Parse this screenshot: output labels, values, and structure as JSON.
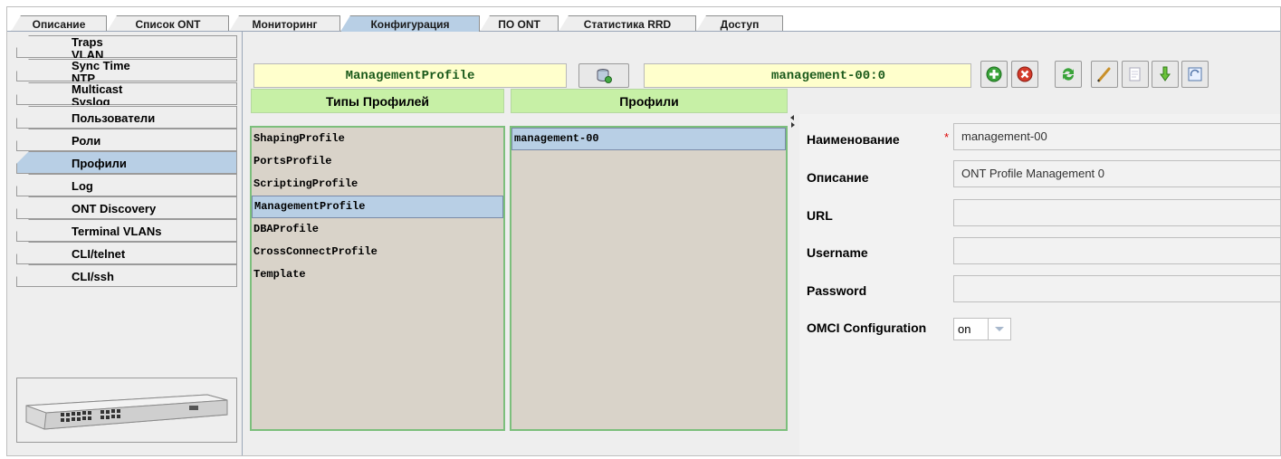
{
  "tabs": [
    {
      "label": "Описание",
      "active": false
    },
    {
      "label": "Список ONT",
      "active": false
    },
    {
      "label": "Мониторинг",
      "active": false
    },
    {
      "label": "Конфигурация",
      "active": true
    },
    {
      "label": "ПО ONT",
      "active": false
    },
    {
      "label": "Статистика RRD",
      "active": false
    },
    {
      "label": "Доступ",
      "active": false
    }
  ],
  "sidebar": {
    "items": [
      {
        "line1": "Traps",
        "line2": "VLAN"
      },
      {
        "line1": "Sync Time",
        "line2": "NTP"
      },
      {
        "line1": "Multicast",
        "line2": "Syslog"
      },
      {
        "label": "Пользователи"
      },
      {
        "label": "Роли"
      },
      {
        "label": "Профили",
        "active": true
      },
      {
        "label": "Log"
      },
      {
        "label": "ONT Discovery"
      },
      {
        "label": "Terminal VLANs"
      },
      {
        "label": "CLI/telnet"
      },
      {
        "label": "CLI/ssh"
      }
    ],
    "device_image": "olt-device-image"
  },
  "toolbar": {
    "profile_type": "ManagementProfile",
    "profile_name": "management-00:0",
    "icons": [
      "db-icon",
      "add-icon",
      "delete-icon",
      "refresh-icon",
      "edit-icon",
      "copy-icon",
      "download-icon",
      "compare-icon"
    ]
  },
  "types_list": {
    "header": "Типы Профилей",
    "items": [
      "ShapingProfile",
      "PortsProfile",
      "ScriptingProfile",
      "ManagementProfile",
      "DBAProfile",
      "CrossConnectProfile",
      "Template"
    ],
    "selected": "ManagementProfile"
  },
  "profiles_list": {
    "header": "Профили",
    "items": [
      "management-00"
    ],
    "selected": "management-00"
  },
  "form": {
    "name_label": "Наименование",
    "name_required": "*",
    "name_value": "management-00",
    "desc_label": "Описание",
    "desc_value": "ONT Profile Management 0",
    "url_label": "URL",
    "url_value": "",
    "username_label": "Username",
    "username_value": "",
    "password_label": "Password",
    "password_value": "",
    "omci_label": "OMCI Configuration",
    "omci_value": "on"
  },
  "colors": {
    "active_tab": "#b8cfe5",
    "list_header": "#c7f0a6",
    "list_bg": "#d9d3c9",
    "yellow_field": "#ffffcc",
    "label_green": "#1b5a1b"
  }
}
